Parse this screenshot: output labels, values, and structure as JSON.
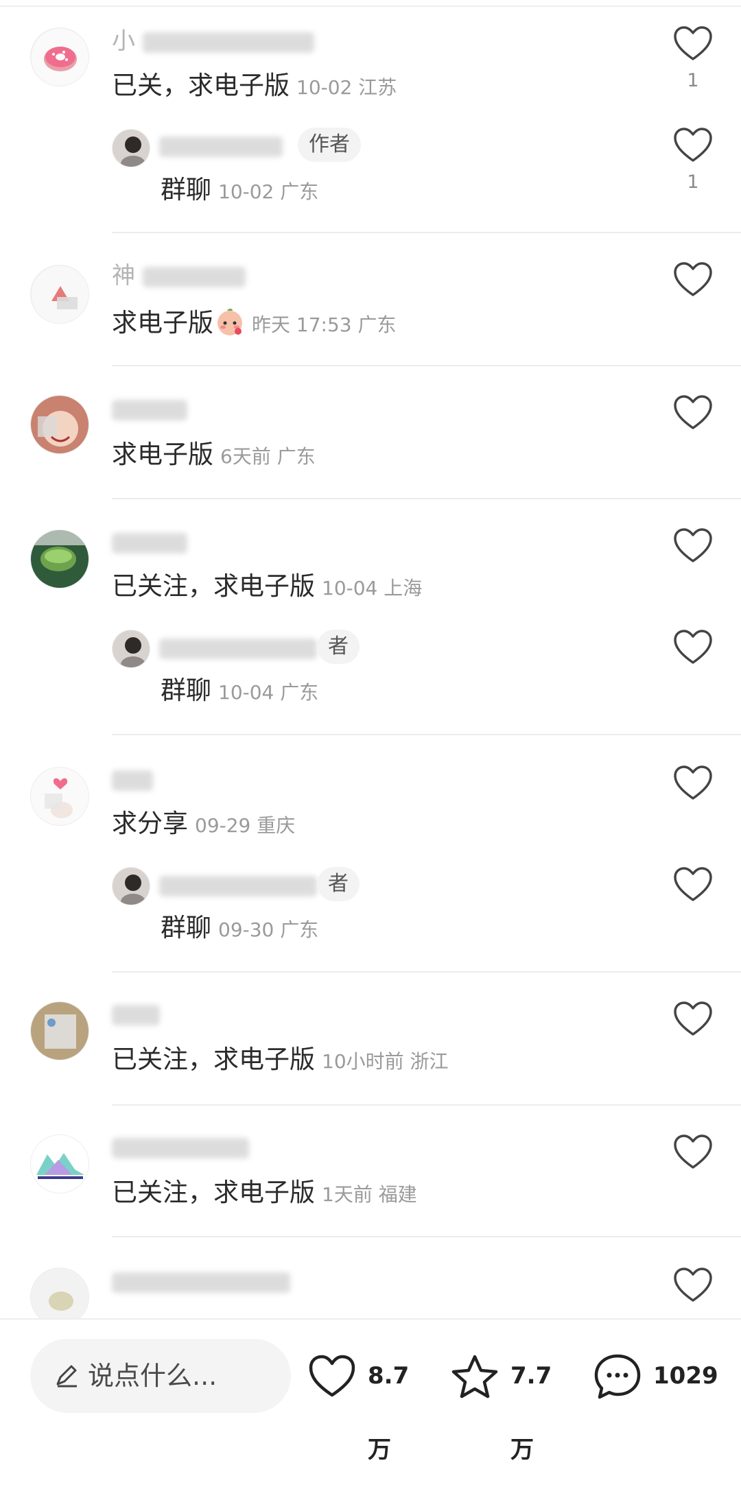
{
  "comments": [
    {
      "username_prefix": "小",
      "text": "已关，求电子版",
      "date": "10-02",
      "location": "江苏",
      "likes": "1"
    },
    {
      "reply": true,
      "badge": "作者",
      "text": "群聊",
      "date": "10-02",
      "location": "广东",
      "likes": "1"
    },
    {
      "username_prefix": "神",
      "text": "求电子版",
      "date": "昨天 17:53",
      "location": "广东",
      "likes": ""
    },
    {
      "username_prefix": "",
      "text": "求电子版",
      "date": "6天前",
      "location": "广东",
      "likes": ""
    },
    {
      "username_prefix": "",
      "text": "已关注，求电子版",
      "date": "10-04",
      "location": "上海",
      "likes": ""
    },
    {
      "reply": true,
      "badge": "者",
      "text": "群聊",
      "date": "10-04",
      "location": "广东",
      "likes": ""
    },
    {
      "username_prefix": "",
      "text": "求分享",
      "date": "09-29",
      "location": "重庆",
      "likes": ""
    },
    {
      "reply": true,
      "badge": "者",
      "text": "群聊",
      "date": "09-30",
      "location": "广东",
      "likes": ""
    },
    {
      "username_prefix": "",
      "text": "已关注，求电子版",
      "date": "10小时前",
      "location": "浙江",
      "likes": ""
    },
    {
      "username_prefix": "",
      "text": "已关注，求电子版",
      "date": "1天前",
      "location": "福建",
      "likes": ""
    }
  ],
  "bottom_bar": {
    "placeholder": "说点什么...",
    "like_count": "8.7万",
    "favorite_count": "7.7万",
    "comment_count": "1029"
  }
}
